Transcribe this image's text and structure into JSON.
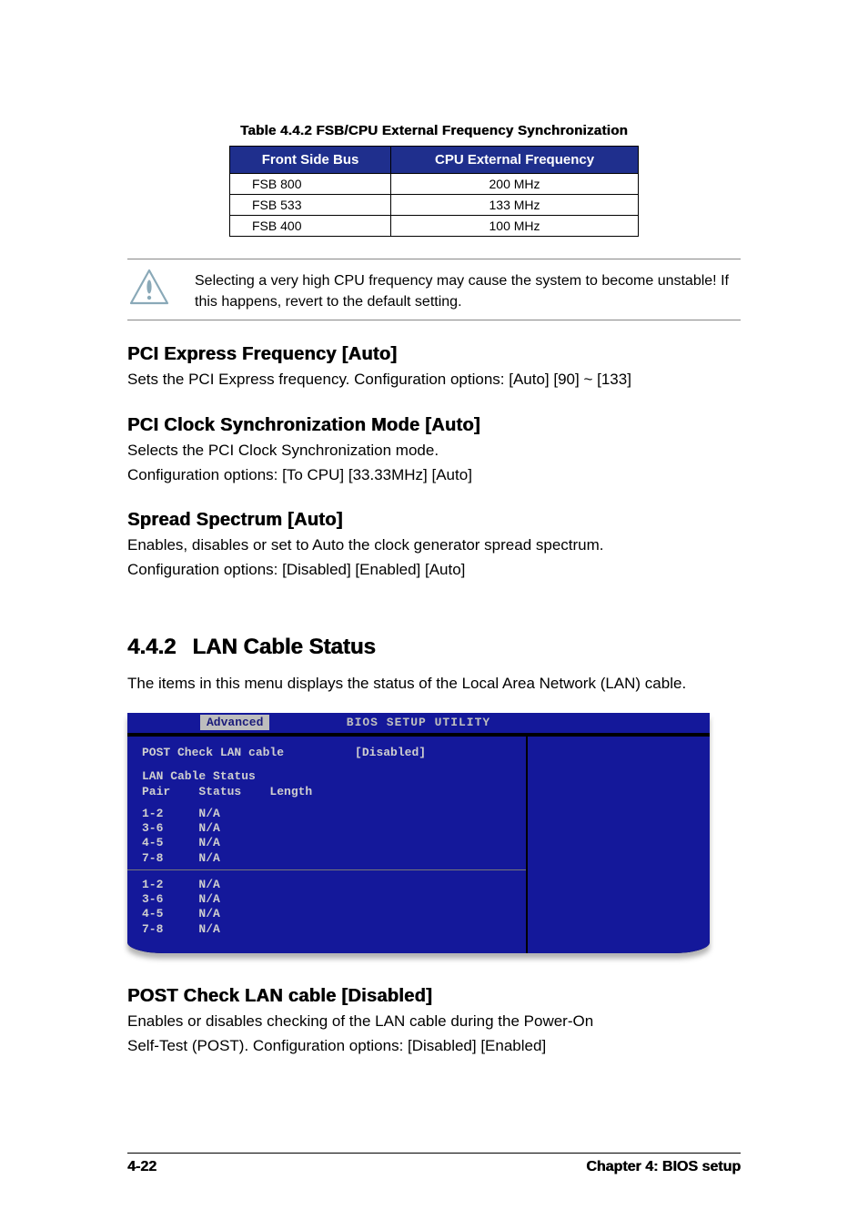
{
  "table": {
    "caption": "Table 4.4.2 FSB/CPU External Frequency Synchronization",
    "headers": [
      "Front Side Bus",
      "CPU External Frequency"
    ],
    "rows": [
      [
        "FSB 800",
        "200 MHz"
      ],
      [
        "FSB 533",
        "133 MHz"
      ],
      [
        "FSB 400",
        "100 MHz"
      ]
    ]
  },
  "warning_note": "Selecting a very high CPU frequency may cause the system to become unstable! If this happens, revert to the default setting.",
  "settings": {
    "pci_express": {
      "title": "PCI Express Frequency [Auto]",
      "desc": "Sets the PCI Express frequency. Configuration options: [Auto] [90] ~ [133]"
    },
    "pci_clock": {
      "title": "PCI Clock Synchronization Mode [Auto]",
      "desc1": "Selects the PCI Clock Synchronization mode.",
      "desc2": "Configuration options: [To CPU] [33.33MHz] [Auto]"
    },
    "spread": {
      "title": "Spread Spectrum [Auto]",
      "desc1": "Enables, disables or set to Auto the clock generator spread spectrum.",
      "desc2": "Configuration options: [Disabled] [Enabled] [Auto]"
    },
    "post_check": {
      "title": "POST Check LAN cable [Disabled]",
      "desc1": "Enables or disables checking of the LAN cable during the Power-On",
      "desc2": "Self-Test (POST). Configuration options: [Disabled] [Enabled]"
    }
  },
  "section": {
    "number": "4.4.2",
    "title": "LAN Cable Status",
    "intro": "The items in this menu displays the status of the Local Area Network (LAN) cable."
  },
  "bios": {
    "title": "BIOS SETUP UTILITY",
    "tab": "Advanced",
    "item_label": "POST Check LAN cable",
    "item_value": "[Disabled]",
    "group_label": "LAN Cable Status",
    "columns": "Pair    Status    Length",
    "block1": [
      "1-2     N/A",
      "3-6     N/A",
      "4-5     N/A",
      "7-8     N/A"
    ],
    "block2": [
      "1-2     N/A",
      "3-6     N/A",
      "4-5     N/A",
      "7-8     N/A"
    ]
  },
  "footer": {
    "left": "4-22",
    "right": "Chapter 4: BIOS setup"
  }
}
